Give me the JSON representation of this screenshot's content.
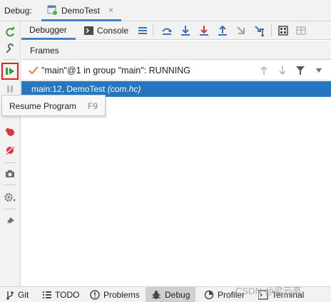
{
  "title_strip": {
    "label": "Debug:",
    "run_tab": {
      "label": "DemoTest",
      "close": "×"
    }
  },
  "left_toolbar": {
    "items": [
      {
        "name": "rerun-icon"
      },
      {
        "name": "modify-run-config-icon"
      },
      {
        "name": "resume-program-icon",
        "active": true
      },
      {
        "name": "pause-program-icon"
      },
      {
        "name": "view-breakpoints-icon"
      },
      {
        "name": "mute-breakpoints-icon"
      },
      {
        "name": "camera-icon"
      },
      {
        "name": "settings-icon"
      },
      {
        "name": "pin-icon"
      }
    ]
  },
  "debugger_toolbar": {
    "tabs": [
      {
        "label": "Debugger",
        "selected": true
      },
      {
        "label": "Console",
        "selected": false
      }
    ],
    "icons": [
      "menu-icon",
      "show-execution-point-icon",
      "step-over-icon",
      "step-into-icon",
      "step-out-icon",
      "run-to-cursor-icon",
      "evaluate-expression-icon",
      "table-icon",
      "restore-layout-icon"
    ]
  },
  "frames": {
    "header": "Frames",
    "thread": "\"main\"@1 in group \"main\": RUNNING",
    "selected_frame": {
      "location": "main:12, DemoTest",
      "package": "(com.hc)"
    }
  },
  "tooltip": {
    "label": "Resume Program",
    "shortcut": "F9"
  },
  "status_bar": {
    "items": [
      {
        "label": "Git",
        "icon": "git-icon"
      },
      {
        "label": "TODO",
        "icon": "todo-icon"
      },
      {
        "label": "Problems",
        "icon": "problems-icon"
      },
      {
        "label": "Debug",
        "icon": "debug-icon",
        "selected": true
      },
      {
        "label": "Profiler",
        "icon": "profiler-icon"
      },
      {
        "label": "Terminal",
        "icon": "terminal-icon"
      }
    ]
  },
  "watermark": "CSDN @梁云亮",
  "colors": {
    "accent": "#4083c9",
    "selection": "#2675bf",
    "active_border": "#e0241b",
    "resume_green": "#3a9a3a"
  }
}
